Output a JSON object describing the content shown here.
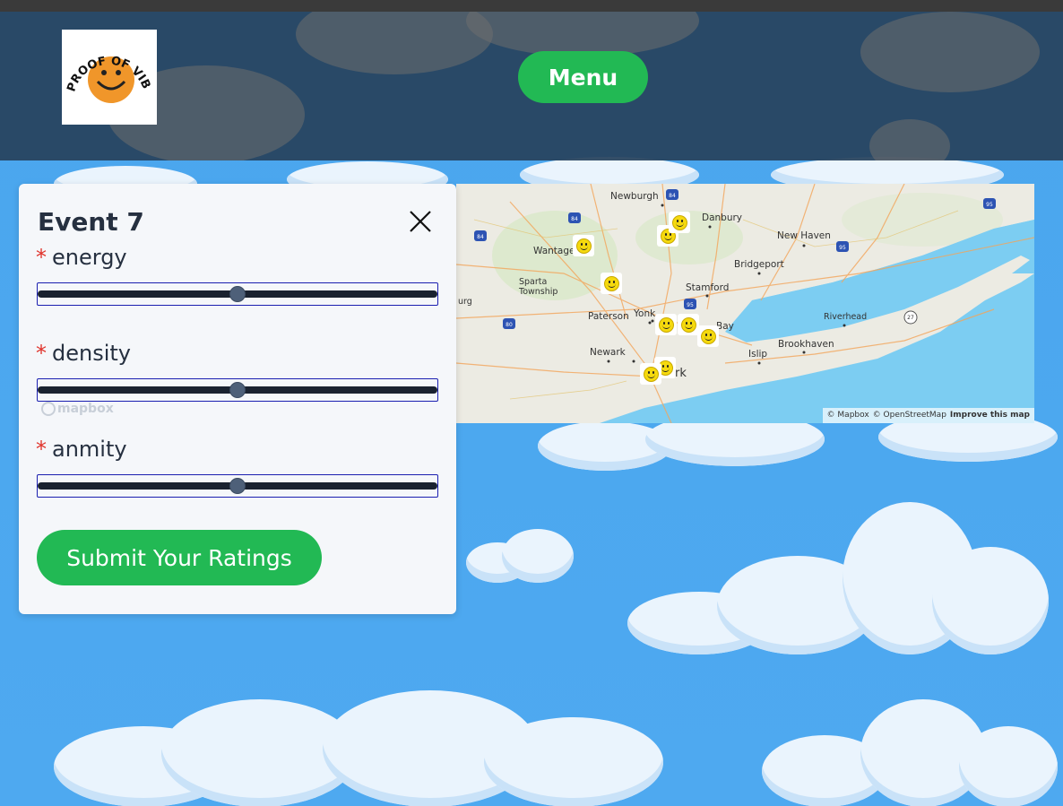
{
  "header": {
    "logo_text": "PROOF OF VIBES",
    "menu_label": "Menu"
  },
  "map": {
    "labels": [
      "Newburgh",
      "Danbury",
      "New Haven",
      "Wantage",
      "Bridgeport",
      "Sparta Township",
      "Stamford",
      "Paterson",
      "Yonk",
      "Riverhead",
      "Newark",
      "Islip",
      "Brookhaven",
      "rk",
      "Bay",
      "urg"
    ],
    "attribution": {
      "mapbox": "© Mapbox",
      "osm": "© OpenStreetMap",
      "improve": "Improve this map"
    },
    "mapbox_logo": "mapbox",
    "marker_icon": "smiley-face-icon",
    "highway_shields": [
      "84",
      "84",
      "84",
      "95",
      "95",
      "80",
      "95",
      "27"
    ]
  },
  "panel": {
    "title": "Event 7",
    "required_mark": "*",
    "fields": [
      {
        "label": "energy",
        "value": 50
      },
      {
        "label": "density",
        "value": 50
      },
      {
        "label": "anmity",
        "value": 50
      }
    ],
    "submit_label": "Submit Your Ratings"
  },
  "colors": {
    "accent_green": "#22b954",
    "header_bg": "#27425c",
    "sky": "#4aa6ee",
    "required": "#e0332b"
  }
}
